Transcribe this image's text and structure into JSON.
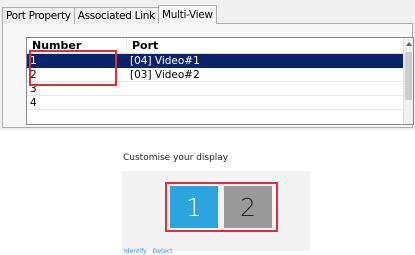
{
  "tabs": [
    {
      "label": "Port Property",
      "active": false
    },
    {
      "label": "Associated Link",
      "active": false
    },
    {
      "label": "Multi-View",
      "active": true
    }
  ],
  "listview": {
    "columns": [
      "Number",
      "Port"
    ],
    "rows": [
      {
        "number": "1",
        "port": "[04] Video#1",
        "selected": true
      },
      {
        "number": "2",
        "port": "[03] Video#2",
        "selected": false
      },
      {
        "number": "3",
        "port": "",
        "selected": false
      },
      {
        "number": "4",
        "port": "",
        "selected": false
      }
    ]
  },
  "display_settings": {
    "title": "Customise your display",
    "monitors": [
      {
        "label": "1",
        "color": "#2ca4e0"
      },
      {
        "label": "2",
        "color": "#999999"
      }
    ],
    "links": [
      "Identify",
      "Detect"
    ]
  },
  "colors": {
    "selection": "#0a246a",
    "highlight_box": "#d9303a"
  }
}
